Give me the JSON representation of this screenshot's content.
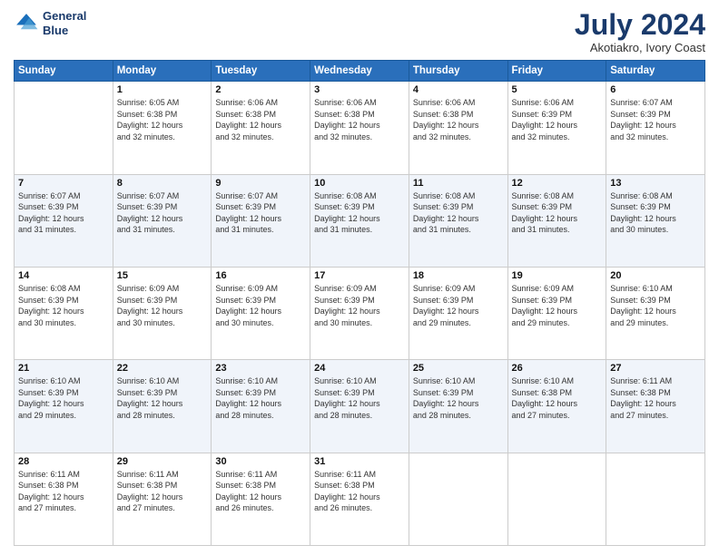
{
  "header": {
    "logo_line1": "General",
    "logo_line2": "Blue",
    "title": "July 2024",
    "subtitle": "Akotiakro, Ivory Coast"
  },
  "days_of_week": [
    "Sunday",
    "Monday",
    "Tuesday",
    "Wednesday",
    "Thursday",
    "Friday",
    "Saturday"
  ],
  "weeks": [
    [
      {
        "day": "",
        "info": ""
      },
      {
        "day": "1",
        "info": "Sunrise: 6:05 AM\nSunset: 6:38 PM\nDaylight: 12 hours\nand 32 minutes."
      },
      {
        "day": "2",
        "info": "Sunrise: 6:06 AM\nSunset: 6:38 PM\nDaylight: 12 hours\nand 32 minutes."
      },
      {
        "day": "3",
        "info": "Sunrise: 6:06 AM\nSunset: 6:38 PM\nDaylight: 12 hours\nand 32 minutes."
      },
      {
        "day": "4",
        "info": "Sunrise: 6:06 AM\nSunset: 6:38 PM\nDaylight: 12 hours\nand 32 minutes."
      },
      {
        "day": "5",
        "info": "Sunrise: 6:06 AM\nSunset: 6:39 PM\nDaylight: 12 hours\nand 32 minutes."
      },
      {
        "day": "6",
        "info": "Sunrise: 6:07 AM\nSunset: 6:39 PM\nDaylight: 12 hours\nand 32 minutes."
      }
    ],
    [
      {
        "day": "7",
        "info": "Sunrise: 6:07 AM\nSunset: 6:39 PM\nDaylight: 12 hours\nand 31 minutes."
      },
      {
        "day": "8",
        "info": "Sunrise: 6:07 AM\nSunset: 6:39 PM\nDaylight: 12 hours\nand 31 minutes."
      },
      {
        "day": "9",
        "info": "Sunrise: 6:07 AM\nSunset: 6:39 PM\nDaylight: 12 hours\nand 31 minutes."
      },
      {
        "day": "10",
        "info": "Sunrise: 6:08 AM\nSunset: 6:39 PM\nDaylight: 12 hours\nand 31 minutes."
      },
      {
        "day": "11",
        "info": "Sunrise: 6:08 AM\nSunset: 6:39 PM\nDaylight: 12 hours\nand 31 minutes."
      },
      {
        "day": "12",
        "info": "Sunrise: 6:08 AM\nSunset: 6:39 PM\nDaylight: 12 hours\nand 31 minutes."
      },
      {
        "day": "13",
        "info": "Sunrise: 6:08 AM\nSunset: 6:39 PM\nDaylight: 12 hours\nand 30 minutes."
      }
    ],
    [
      {
        "day": "14",
        "info": "Sunrise: 6:08 AM\nSunset: 6:39 PM\nDaylight: 12 hours\nand 30 minutes."
      },
      {
        "day": "15",
        "info": "Sunrise: 6:09 AM\nSunset: 6:39 PM\nDaylight: 12 hours\nand 30 minutes."
      },
      {
        "day": "16",
        "info": "Sunrise: 6:09 AM\nSunset: 6:39 PM\nDaylight: 12 hours\nand 30 minutes."
      },
      {
        "day": "17",
        "info": "Sunrise: 6:09 AM\nSunset: 6:39 PM\nDaylight: 12 hours\nand 30 minutes."
      },
      {
        "day": "18",
        "info": "Sunrise: 6:09 AM\nSunset: 6:39 PM\nDaylight: 12 hours\nand 29 minutes."
      },
      {
        "day": "19",
        "info": "Sunrise: 6:09 AM\nSunset: 6:39 PM\nDaylight: 12 hours\nand 29 minutes."
      },
      {
        "day": "20",
        "info": "Sunrise: 6:10 AM\nSunset: 6:39 PM\nDaylight: 12 hours\nand 29 minutes."
      }
    ],
    [
      {
        "day": "21",
        "info": "Sunrise: 6:10 AM\nSunset: 6:39 PM\nDaylight: 12 hours\nand 29 minutes."
      },
      {
        "day": "22",
        "info": "Sunrise: 6:10 AM\nSunset: 6:39 PM\nDaylight: 12 hours\nand 28 minutes."
      },
      {
        "day": "23",
        "info": "Sunrise: 6:10 AM\nSunset: 6:39 PM\nDaylight: 12 hours\nand 28 minutes."
      },
      {
        "day": "24",
        "info": "Sunrise: 6:10 AM\nSunset: 6:39 PM\nDaylight: 12 hours\nand 28 minutes."
      },
      {
        "day": "25",
        "info": "Sunrise: 6:10 AM\nSunset: 6:39 PM\nDaylight: 12 hours\nand 28 minutes."
      },
      {
        "day": "26",
        "info": "Sunrise: 6:10 AM\nSunset: 6:38 PM\nDaylight: 12 hours\nand 27 minutes."
      },
      {
        "day": "27",
        "info": "Sunrise: 6:11 AM\nSunset: 6:38 PM\nDaylight: 12 hours\nand 27 minutes."
      }
    ],
    [
      {
        "day": "28",
        "info": "Sunrise: 6:11 AM\nSunset: 6:38 PM\nDaylight: 12 hours\nand 27 minutes."
      },
      {
        "day": "29",
        "info": "Sunrise: 6:11 AM\nSunset: 6:38 PM\nDaylight: 12 hours\nand 27 minutes."
      },
      {
        "day": "30",
        "info": "Sunrise: 6:11 AM\nSunset: 6:38 PM\nDaylight: 12 hours\nand 26 minutes."
      },
      {
        "day": "31",
        "info": "Sunrise: 6:11 AM\nSunset: 6:38 PM\nDaylight: 12 hours\nand 26 minutes."
      },
      {
        "day": "",
        "info": ""
      },
      {
        "day": "",
        "info": ""
      },
      {
        "day": "",
        "info": ""
      }
    ]
  ]
}
